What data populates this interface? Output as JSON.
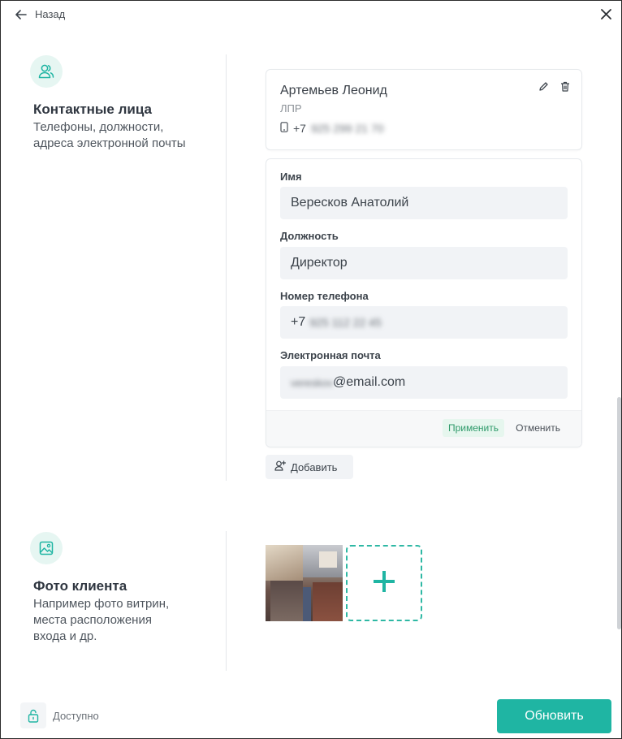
{
  "header": {
    "back_label": "Назад"
  },
  "contacts_section": {
    "title": "Контактные лица",
    "description": "Телефоны, должности, адреса электронной почты",
    "contact": {
      "name": "Артемьев Леонид",
      "role": "ЛПР",
      "phone_prefix": "+7",
      "phone_rest": "925 299 21 70"
    },
    "form": {
      "name_label": "Имя",
      "name_value": "Вересков Анатолий",
      "position_label": "Должность",
      "position_value": "Директор",
      "phone_label": "Номер телефона",
      "phone_prefix": "+7",
      "phone_rest": "925 112 22 45",
      "email_label": "Электронная почта",
      "email_local": "vereskov",
      "email_domain": "@email.com",
      "apply_label": "Применить",
      "cancel_label": "Отменить"
    },
    "add_label": "Добавить"
  },
  "photo_section": {
    "title": "Фото клиента",
    "description": "Например фото витрин, места расположения входа и др."
  },
  "footer": {
    "availability_label": "Доступно",
    "update_label": "Обновить"
  },
  "colors": {
    "accent": "#1fb5a3",
    "accent_light": "#e6f6f2",
    "field_bg": "#f1f3f6"
  },
  "icons": [
    "arrow-left-icon",
    "close-icon",
    "contacts-icon",
    "pencil-icon",
    "trash-icon",
    "phone-icon",
    "add-user-icon",
    "image-icon",
    "plus-icon",
    "unlock-icon"
  ]
}
